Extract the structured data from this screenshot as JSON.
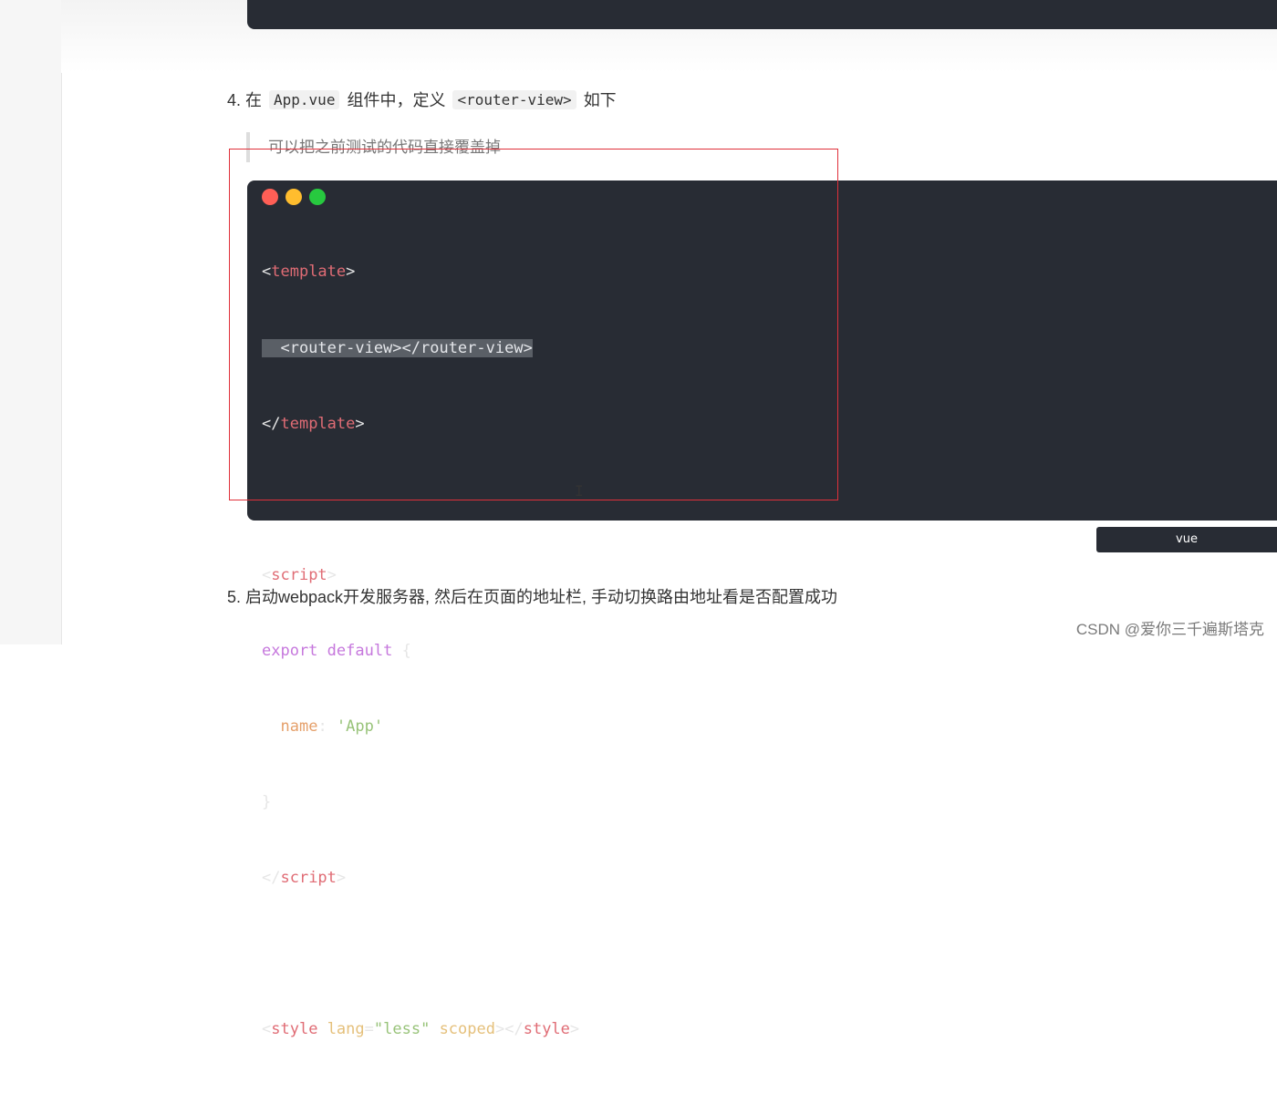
{
  "step4": {
    "prefix": "4. 在",
    "code1": "App.vue",
    "middle": "组件中，定义",
    "code2": "<router-view>",
    "suffix": "如下"
  },
  "quote": "可以把之前测试的代码直接覆盖掉",
  "window_dots": {
    "red": "#ff5f56",
    "yellow": "#ffbd2e",
    "green": "#27c93f"
  },
  "code": {
    "t_lt": "<",
    "t_lt_slash": "</",
    "t_gt": ">",
    "template": "template",
    "router_view_line": "  <router-view></router-view>",
    "script": "script",
    "export": "export",
    "default": "default",
    "brace_open": "{",
    "indent": "  ",
    "name_key": "name",
    "colon": ": ",
    "app_str": "'App'",
    "brace_close": "}",
    "style": "style",
    "lang": "lang",
    "eq": "=",
    "less_str": "\"less\"",
    "scoped": "scoped",
    "space": " "
  },
  "lang_label": "vue",
  "step5": "5. 启动webpack开发服务器, 然后在页面的地址栏, 手动切换路由地址看是否配置成功",
  "watermark": "CSDN @爱你三千遍斯塔克",
  "cursor_glyph": "I",
  "colors": {
    "code_bg": "#282c34",
    "highlight_box": "#e0303a"
  }
}
